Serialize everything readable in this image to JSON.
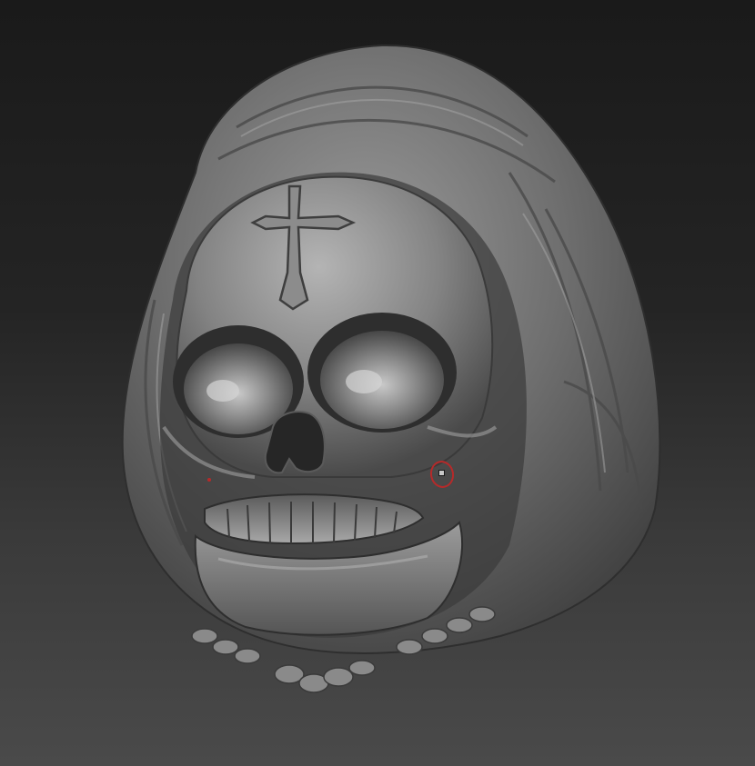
{
  "viewport": {
    "background_top": "#1a1a1a",
    "background_bottom": "#4a4a4a"
  },
  "model": {
    "material_color": "#7a7a7a",
    "highlight_color": "#c8c8c8",
    "shadow_color": "#2a2a2a"
  },
  "brush": {
    "cursor_color": "#b52a2a",
    "icon": "brush-cursor-icon"
  }
}
